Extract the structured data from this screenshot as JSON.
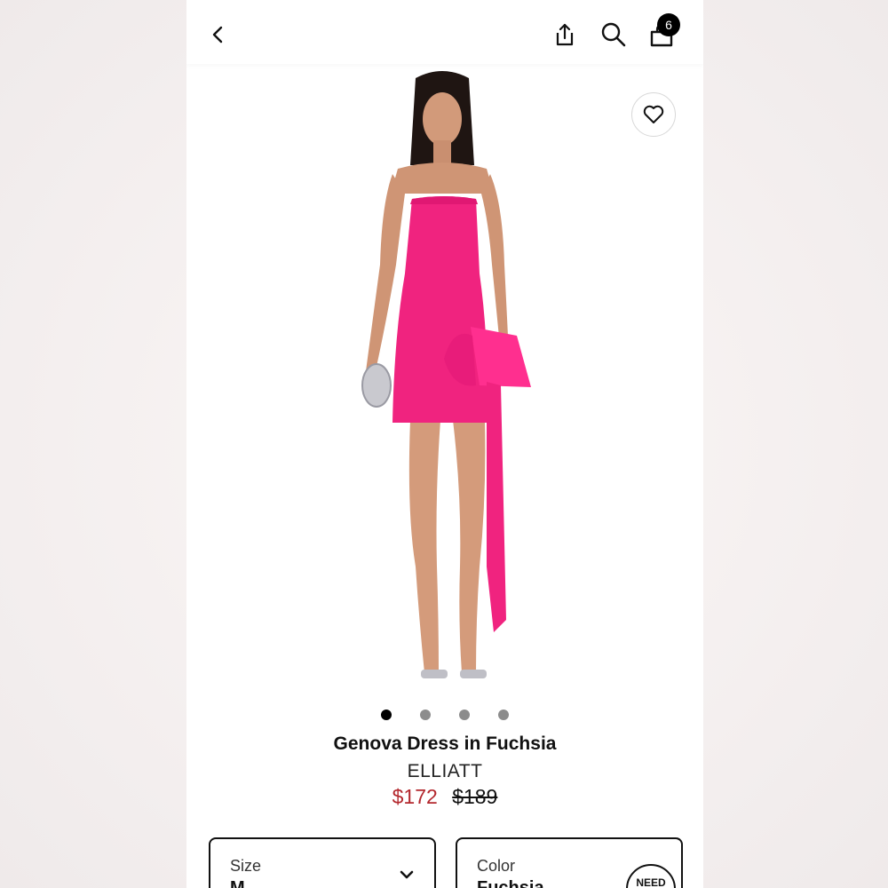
{
  "header": {
    "back_icon": "chevron-left-icon",
    "share_icon": "share-icon",
    "search_icon": "search-icon",
    "bag_icon": "shopping-bag-icon",
    "cart_count": "6"
  },
  "product": {
    "favorite_icon": "heart-icon",
    "image_dots": {
      "count": 4,
      "active_index": 0
    },
    "title": "Genova Dress in Fuchsia",
    "brand": "ELLIATT",
    "price_sale": "$172",
    "price_original": "$189",
    "dress_color": "#f0237f",
    "sale_color": "#b3272d"
  },
  "options": {
    "size": {
      "label": "Size",
      "value": "M"
    },
    "color": {
      "label": "Color",
      "value": "Fuchsia"
    },
    "need_help_label": "NEED"
  }
}
